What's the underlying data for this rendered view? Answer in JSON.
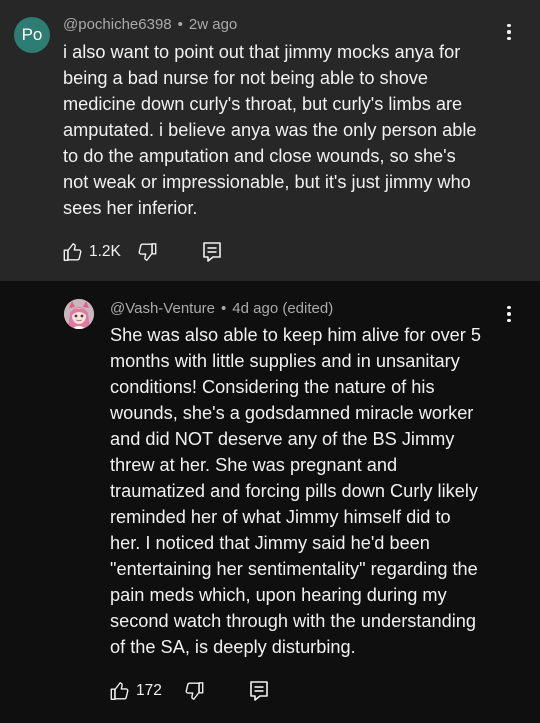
{
  "comments": [
    {
      "avatar_text": "Po",
      "avatar_color": "#2e7d73",
      "username": "@pochiche6398",
      "separator": "•",
      "time": "2w ago",
      "lines": [
        "i also want to point out that jimmy mocks anya for",
        "being a bad nurse for not being able to shove",
        "medicine down curly's throat, but curly's limbs are",
        "amputated. i believe anya was the only person able",
        "to do the amputation and close wounds, so she's",
        "not weak or impressionable, but it's just jimmy who",
        "sees her inferior."
      ],
      "likes": "1.2K",
      "menu_icon": "more-vertical-icon"
    },
    {
      "avatar_icon": "anime-avatar-icon",
      "username": "@Vash-Venture",
      "separator": "•",
      "time": "4d ago (edited)",
      "lines": [
        "She was also able to keep him alive for over 5",
        "months with little supplies and in unsanitary",
        "conditions! Considering the nature of his",
        "wounds, she's a godsdamned miracle worker",
        "and did NOT deserve any of the BS Jimmy",
        "threw at her. She was pregnant and",
        "traumatized and forcing pills down Curly likely",
        "reminded her of what Jimmy himself did to",
        "her. I noticed that Jimmy said he'd been",
        "\"entertaining her sentimentality\" regarding the",
        "pain meds which, upon hearing during my",
        "second watch through with the understanding",
        "of the SA, is deeply disturbing."
      ],
      "likes": "172",
      "menu_icon": "more-vertical-icon"
    }
  ],
  "theme": {
    "top_comment_bg": "#272727",
    "page_bg": "#0f0f0f",
    "text": "#f1f1f1",
    "meta_text": "#aaaaaa"
  }
}
